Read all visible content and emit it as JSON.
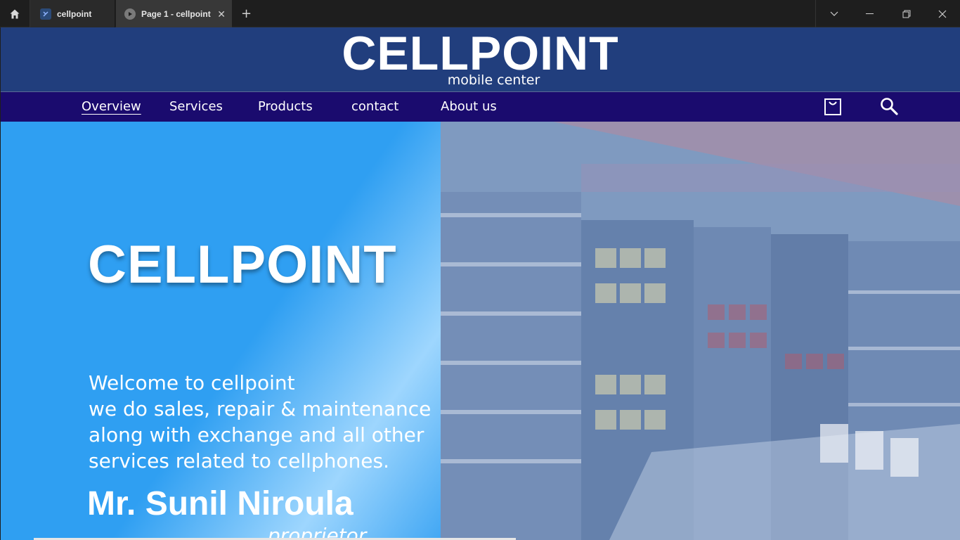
{
  "tabs": [
    {
      "label": "cellpoint",
      "icon": "app-icon"
    },
    {
      "label": "Page 1 - cellpoint",
      "icon": "play-icon",
      "close": "✕"
    }
  ],
  "new_tab": "+",
  "site": {
    "logo_main": "CELLPOINT",
    "logo_sub": "mobile center"
  },
  "nav": {
    "items": [
      "Overview",
      "Services",
      "Products",
      "contact",
      "About us"
    ],
    "active": "Overview"
  },
  "hero": {
    "title": "CELLPOINT",
    "lines": [
      "Welcome to cellpoint",
      "we do sales, repair & maintenance",
      "along with exchange and all other",
      "services related to cellphones."
    ],
    "owner_name": "Mr. Sunil Niroula",
    "owner_role": "proprietor"
  },
  "colors": {
    "header": "#213e7d",
    "nav": "#1a0b6e",
    "hero": "#2f9ff2"
  }
}
